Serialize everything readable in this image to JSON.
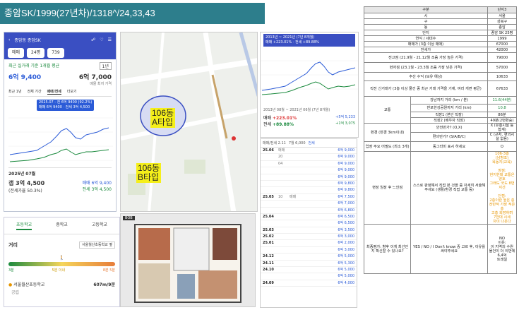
{
  "title": "종암SK/1999(27년차)/1318^/24,33,43",
  "phone": {
    "app_title": "종암동 종암SK",
    "deal_chip": "매매",
    "size_chip": "24평",
    "count_chip": "739",
    "year_chip": "1년",
    "recent_label": "최근 실거래 기준 1개월 평균",
    "deal_price": "6억 9,400",
    "jeonse_label": "매물 최저 가격",
    "jeonse_price": "6억 7,000",
    "tabs": [
      "최근 1년",
      "전체 기간",
      "매매/전세",
      "더보기"
    ],
    "tooltip_line1": "2025.07 - 전 6억 9400 (92.2%)",
    "tooltip_line2": "매매 6억 9400 · 전세 3억 4,500",
    "month_label": "2025년 07월",
    "summary_price": "갭 3억 4,500",
    "summary_rate": "(전세가율 50.3%)",
    "deal_small": "매매 6억 9,400",
    "jeonse_small": "전세 3억 4,500"
  },
  "school": {
    "tabs": [
      "초등학교",
      "중학교",
      "고등학교"
    ],
    "distance_label": "거리",
    "school_tag": "서울월산초등학교 옆",
    "scale": [
      "3분",
      "5분 이내",
      "8분 5분"
    ],
    "school_name": "서울월산초등학교",
    "school_dist": "607m/9분",
    "school_sub": "공립"
  },
  "map": {
    "label_a": "106동\nA타입",
    "label_b": "106동\nB타입"
  },
  "plan": {
    "tag": "BOB"
  },
  "chart2": {
    "tooltip1": "2013년 ~ 2021년 (7년 8개월)",
    "tooltip2": "매매 +223.01% · 전세 +89.88%",
    "foot_title": "2013년 08월 ~ 2021년 06월 (7년 8개월)",
    "row1_label": "매매",
    "row1_pct": "+223.01%",
    "row1_amt": "+5억 5,233",
    "row2_label": "전세",
    "row2_pct": "+89.88%",
    "row2_amt": "+1억 3,075"
  },
  "txlist": {
    "header": [
      "매매/전세 2.11",
      "7월 6,000",
      "전세"
    ],
    "rows": [
      {
        "d": "25.06",
        "t": "매매",
        "f": "",
        "p": "6억 9,000"
      },
      {
        "d": "",
        "t": "20",
        "f": "",
        "p": "6억 9,000"
      },
      {
        "d": "",
        "t": "04",
        "f": "",
        "p": "6억 9,000"
      },
      {
        "d": "",
        "t": "",
        "f": "",
        "p": "6억 9,000"
      },
      {
        "d": "",
        "t": "",
        "f": "",
        "p": "6억 9,000"
      },
      {
        "d": "",
        "t": "",
        "f": "",
        "p": "6억 9,800"
      },
      {
        "d": "",
        "t": "",
        "f": "",
        "p": "6억 9,800"
      },
      {
        "d": "25.05",
        "t": "10",
        "f": "매매",
        "p": "6억 7,500"
      },
      {
        "d": "",
        "t": "",
        "f": "",
        "p": "6억 7,000"
      },
      {
        "d": "",
        "t": "",
        "f": "",
        "p": "6억 6,800"
      },
      {
        "d": "25.04",
        "t": "",
        "f": "",
        "p": "6억 6,500"
      },
      {
        "d": "",
        "t": "",
        "f": "",
        "p": "6억 6,500"
      },
      {
        "d": "25.03",
        "t": "",
        "f": "",
        "p": "6억 3,500"
      },
      {
        "d": "25.02",
        "t": "",
        "f": "",
        "p": "6억 3,000"
      },
      {
        "d": "25.01",
        "t": "",
        "f": "",
        "p": "6억 2,000"
      },
      {
        "d": "",
        "t": "",
        "f": "",
        "p": "6억 3,000"
      },
      {
        "d": "24.12",
        "t": "",
        "f": "",
        "p": "6억 5,000"
      },
      {
        "d": "24.11",
        "t": "",
        "f": "",
        "p": "6억 5,300"
      },
      {
        "d": "24.10",
        "t": "",
        "f": "",
        "p": "6억 5,000"
      },
      {
        "d": "",
        "t": "",
        "f": "",
        "p": "6억 5,000"
      },
      {
        "d": "24.09",
        "t": "",
        "f": "",
        "p": "6억 4,000"
      }
    ]
  },
  "table": {
    "h1": "구분",
    "h2": "단지3",
    "rows": [
      [
        "시",
        "서울"
      ],
      [
        "구",
        "성북구"
      ],
      [
        "동",
        "종암"
      ],
      [
        "단지",
        "종암 SK 25평"
      ],
      [
        "연식 / 세대수",
        "1999"
      ],
      [
        "매매가 (3층 이상 매매)",
        "67000"
      ],
      [
        "전세가",
        "42000"
      ],
      [
        "전고점 (21.9월 - 21.12월 조음 가장 높은 가격)",
        "79000"
      ],
      [
        "현저점 (23.1월 - 23.3월 조음 가장 낮은 가격)",
        "57000"
      ],
      [
        "추산 수익 (보유 예상)",
        "10633"
      ],
      [
        "직전 신거래가 (3층 이상 물건 중 최근 거래 가격을 기재, 여러 개면 평균)",
        "67633"
      ]
    ],
    "traffic_label": "교통",
    "traffic": [
      [
        "강남까지 거리 (km / 분)",
        "11.6(44분)"
      ],
      [
        "반포한강공원까지 거리 (km)",
        "10.8"
      ],
      [
        "직장1 (본인 직장)",
        "86분"
      ],
      [
        "직장2 (배우자 직장)",
        "49분(2번환승)"
      ]
    ],
    "env_label": "환경 (반경 3km이내)",
    "env": [
      [
        "안전만가? (O,X)",
        "X (유흥시설 등 합계)"
      ],
      [
        "편의만가? (S/A/B/C)",
        "C (근처, 편의시설 없음)"
      ]
    ],
    "pref_label": "업장 주요 어필도 (최소 3개)",
    "pref_value": "동그라미 표시 하세요",
    "pref_mark": "O",
    "feel_label": "현장 임장 후 느낀점",
    "feel_mid": "스스로 판정해서 직접 본 것을 중 자세히 서술해주세요 (생활/환경 직접 교통 등)",
    "feel_right": "106-3층\n(남향조)\n목동지(교육)\n\n장점:\n현지한테 교통은 양호\n그래도 국도 8번지선\n\n단점:\n2층이란 높은 층\n전반적 가장 적은 층\n고층 희망하며\n7천대 시세\n차이 나온다",
    "final_label": "최종평가: 향후 이게 최선인지 확신할 수 있나요?",
    "final_mid": "YES / NO / I Don't know 중 고르 후, 이유를 써야주세요",
    "final_right": "NO\n이유:\n이 지역의 수원\n물건이 더 이번에\n6,4억\n트레일"
  }
}
